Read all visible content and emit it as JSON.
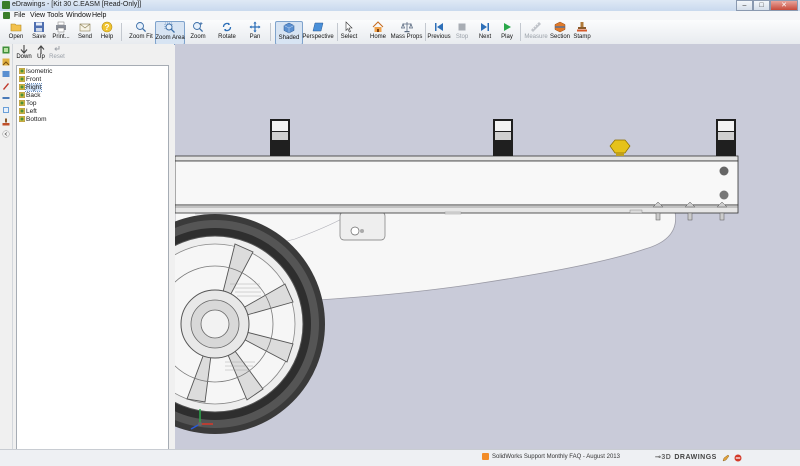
{
  "window": {
    "title": "eDrawings - [Kit 30 C.EASM [Read-Only]]",
    "min_label": "–",
    "max_label": "□",
    "close_label": "✕"
  },
  "menu": [
    "File",
    "View",
    "Tools",
    "Window",
    "Help"
  ],
  "toolbar": {
    "open": "Open",
    "save": "Save",
    "print": "Print...",
    "send": "Send",
    "help": "Help",
    "zoom_fit": "Zoom Fit",
    "zoom_area": "Zoom Area",
    "zoom": "Zoom",
    "rotate": "Rotate",
    "pan": "Pan",
    "shaded": "Shaded",
    "perspective": "Perspective",
    "select": "Select",
    "home": "Home",
    "mass_props": "Mass Props",
    "previous": "Previous",
    "stop": "Stop",
    "next": "Next",
    "play": "Play",
    "measure": "Measure",
    "section": "Section",
    "stamp": "Stamp"
  },
  "panel": {
    "down": "Down",
    "up": "Up",
    "reset": "Reset",
    "views": [
      "Isometric",
      "Front",
      "Right",
      "Back",
      "Top",
      "Left",
      "Bottom"
    ],
    "selected_view": "Right"
  },
  "status": {
    "rss_message": "SolidWorks Support Monthly FAQ - August 2013",
    "brand": "DRAWINGS"
  },
  "colors": {
    "viewport_bg": "#c9cbd9",
    "toolbar_bg": "#eceef1",
    "accent": "#3c7fc6"
  },
  "icons": {
    "open": "folder-open-icon",
    "save": "floppy-icon",
    "print": "printer-icon",
    "send": "envelope-icon",
    "help": "question-icon",
    "zoom": "magnifier-icon",
    "rotate": "rotate-icon",
    "pan": "pan-arrows-icon",
    "shaded": "cube-icon",
    "select": "cursor-icon",
    "home": "house-icon",
    "previous": "skip-back-icon",
    "stop": "stop-icon",
    "next": "skip-forward-icon",
    "play": "play-icon",
    "measure": "ruler-icon",
    "section": "section-icon",
    "stamp": "stamp-icon"
  }
}
